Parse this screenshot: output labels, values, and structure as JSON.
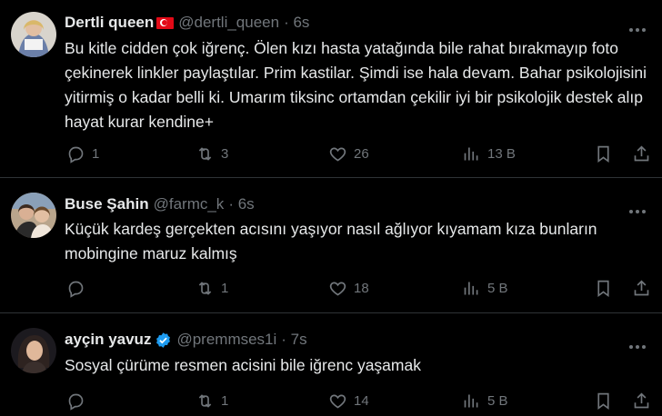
{
  "tweets": [
    {
      "name": "Dertli queen",
      "handle": "@dertli_queen",
      "time": "· 6s",
      "text": "Bu kitle cidden çok iğrenç. Ölen kızı hasta yatağında bile rahat bırakmayıp foto çekinerek linkler paylaştılar. Prim kastilar. Şimdi ise hala devam. Bahar psikolojisini yitirmiş o kadar belli ki. Umarım tiksinc ortamdan çekilir iyi bir psikolojik destek alıp hayat kurar kendine+",
      "replies": "1",
      "retweets": "3",
      "likes": "26",
      "views": "13 B"
    },
    {
      "name": "Buse Şahin",
      "handle": "@farmc_k",
      "time": "· 6s",
      "text": "Küçük kardeş gerçekten acısını yaşıyor nasıl ağlıyor kıyamam kıza bunların mobingine maruz kalmış",
      "replies": "",
      "retweets": "1",
      "likes": "18",
      "views": "5 B"
    },
    {
      "name": "ayçin yavuz",
      "handle": "@premmses1i",
      "time": "· 7s",
      "text": "Sosyal çürüme resmen acisini bile iğrenc yaşamak",
      "replies": "",
      "retweets": "1",
      "likes": "14",
      "views": "5 B"
    }
  ],
  "icons": {
    "flag": "turkey-flag-icon",
    "verified": "verified-badge-icon",
    "reply": "reply-icon",
    "retweet": "retweet-icon",
    "like": "heart-icon",
    "views": "views-icon",
    "bookmark": "bookmark-icon",
    "share": "share-icon",
    "more": "more-icon"
  },
  "colors": {
    "background": "#000000",
    "text": "#e7e9ea",
    "muted": "#71767b",
    "verified": "#1d9bf0",
    "flag": "#e30a17"
  }
}
